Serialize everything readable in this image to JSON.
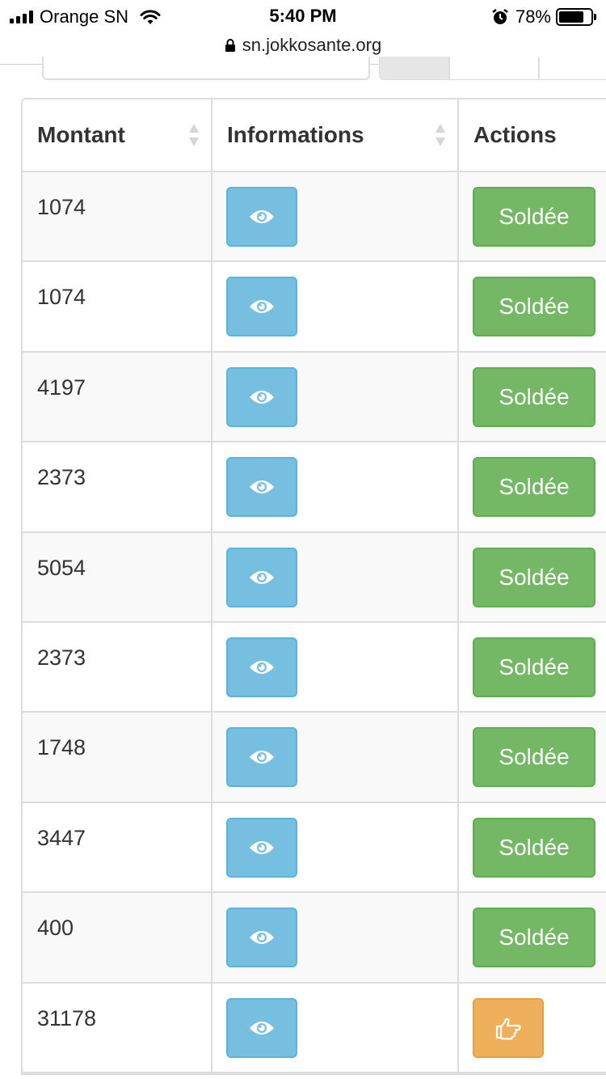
{
  "status_bar": {
    "carrier": "Orange SN",
    "time": "5:40 PM",
    "battery_percent": "78%",
    "battery_level": 0.78,
    "url": "sn.jokkosante.org"
  },
  "table": {
    "headers": {
      "amount": "Montant",
      "info": "Informations",
      "actions": "Actions"
    },
    "rows": [
      {
        "amount": "1074",
        "action": "Soldée",
        "status": "settled"
      },
      {
        "amount": "1074",
        "action": "Soldée",
        "status": "settled"
      },
      {
        "amount": "4197",
        "action": "Soldée",
        "status": "settled"
      },
      {
        "amount": "2373",
        "action": "Soldée",
        "status": "settled"
      },
      {
        "amount": "5054",
        "action": "Soldée",
        "status": "settled"
      },
      {
        "amount": "2373",
        "action": "Soldée",
        "status": "settled"
      },
      {
        "amount": "1748",
        "action": "Soldée",
        "status": "settled"
      },
      {
        "amount": "3447",
        "action": "Soldée",
        "status": "settled"
      },
      {
        "amount": "400",
        "action": "Soldée",
        "status": "settled"
      },
      {
        "amount": "31178",
        "action": "",
        "status": "pending"
      }
    ]
  },
  "colors": {
    "info_button": "#77bfe0",
    "success_button": "#74b866",
    "warning_button": "#eeb05a"
  },
  "icons": {
    "info_button": "eye-icon",
    "pending_action": "hand-pointer-icon"
  }
}
